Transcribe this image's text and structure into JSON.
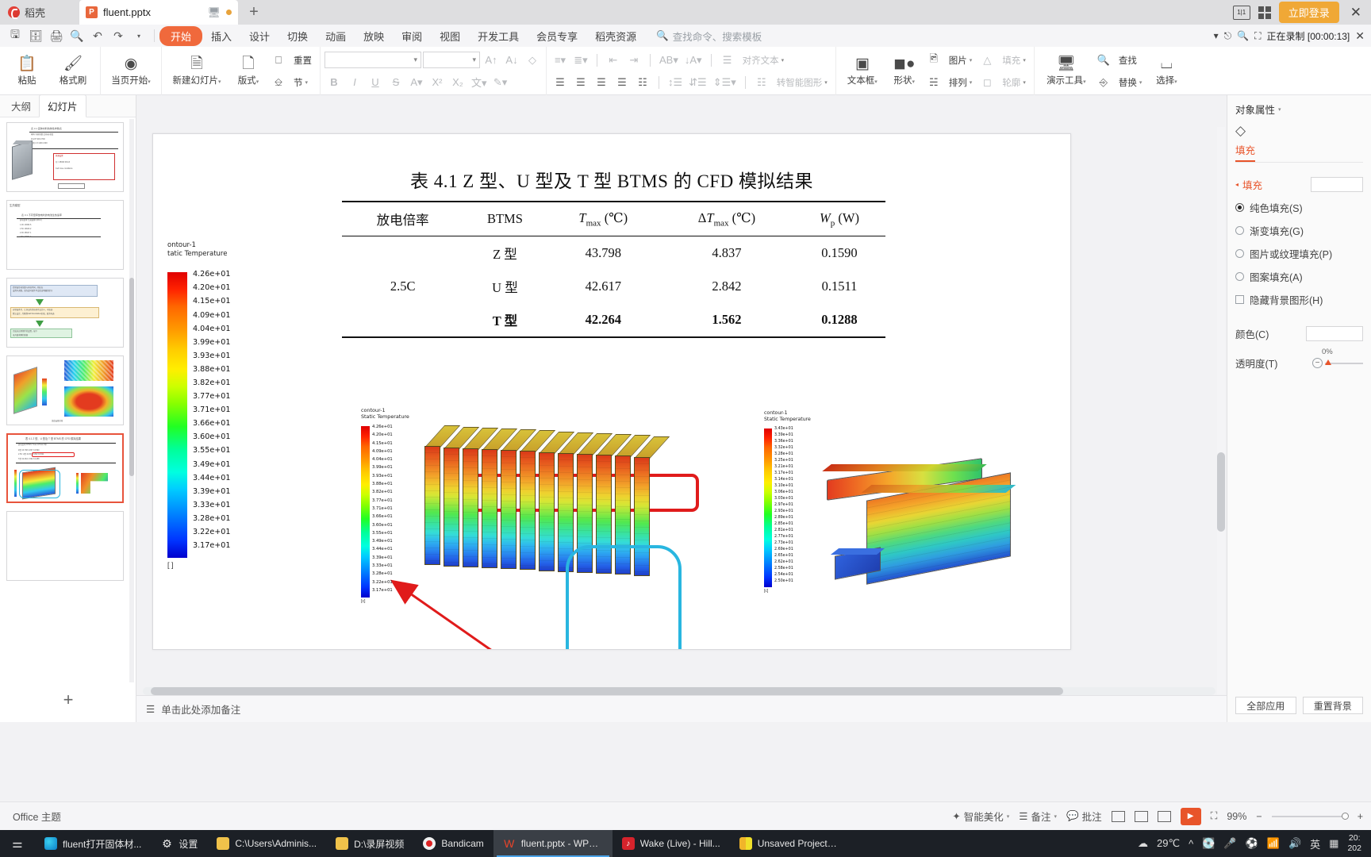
{
  "tabbar": {
    "home_label": "稻壳",
    "doc_tab": "fluent.pptx",
    "plus": "+",
    "login_label": "立即登录",
    "close": "✕"
  },
  "menubar": {
    "quick_icons": [
      "save-icon",
      "save-as-icon",
      "print-icon",
      "print-preview-icon",
      "undo-icon",
      "redo-icon",
      "customize-icon"
    ],
    "items": [
      {
        "label": "开始",
        "active": true
      },
      {
        "label": "插入",
        "active": false
      },
      {
        "label": "设计",
        "active": false
      },
      {
        "label": "切换",
        "active": false
      },
      {
        "label": "动画",
        "active": false
      },
      {
        "label": "放映",
        "active": false
      },
      {
        "label": "审阅",
        "active": false
      },
      {
        "label": "视图",
        "active": false
      },
      {
        "label": "开发工具",
        "active": false
      },
      {
        "label": "会员专享",
        "active": false
      },
      {
        "label": "稻壳资源",
        "active": false
      }
    ],
    "search_placeholder": "查找命令、搜索模板",
    "recording_label": "正在录制 [00:00:13]"
  },
  "ribbon": {
    "clipboard": {
      "paste": "粘贴",
      "format_painter": "格式刷"
    },
    "slides": {
      "from_current": "当页开始",
      "new_slide": "新建幻灯片",
      "layout": "版式",
      "reset": "重置",
      "section": "节"
    },
    "font": {
      "font_name": "",
      "font_size": "",
      "bold": "B",
      "italic": "I",
      "underline": "U",
      "strike": "S"
    },
    "paragraph": {
      "align_text": "对齐文本",
      "smart_art": "转智能图形"
    },
    "insert": {
      "textbox": "文本框",
      "shape": "形状",
      "picture": "图片",
      "arrange": "排列",
      "fill": "填充",
      "outline": "轮廓"
    },
    "tools": {
      "present_tools": "演示工具",
      "find": "查找",
      "replace": "替换",
      "select": "选择"
    }
  },
  "left_pane": {
    "tabs": [
      {
        "label": "大纲",
        "active": false
      },
      {
        "label": "幻灯片",
        "active": true
      }
    ],
    "add_slide": "+",
    "slide_count": 6,
    "selected_index": 5
  },
  "slide": {
    "title": "表 4.1 Z 型、U 型及 T 型 BTMS 的 CFD 模拟结果",
    "table": {
      "headers": [
        "放电倍率",
        "BTMS",
        "Tmax (℃)",
        "ΔTmax (℃)",
        "Wp (W)"
      ],
      "rate": "2.5C",
      "rows": [
        {
          "btms": "Z 型",
          "tmax": "43.798",
          "dtmax": "4.837",
          "wp": "0.1590",
          "bold": false,
          "highlight": false
        },
        {
          "btms": "U 型",
          "tmax": "42.617",
          "dtmax": "2.842",
          "wp": "0.1511",
          "bold": false,
          "highlight": true
        },
        {
          "btms": "T 型",
          "tmax": "42.264",
          "dtmax": "1.562",
          "wp": "0.1288",
          "bold": true,
          "highlight": false
        }
      ]
    },
    "colorbar_big": {
      "title_line1": "ontour-1",
      "title_line2": "tatic Temperature",
      "unit": "[ ]",
      "labels": [
        "4.26e+01",
        "4.20e+01",
        "4.15e+01",
        "4.09e+01",
        "4.04e+01",
        "3.99e+01",
        "3.93e+01",
        "3.88e+01",
        "3.82e+01",
        "3.77e+01",
        "3.71e+01",
        "3.66e+01",
        "3.60e+01",
        "3.55e+01",
        "3.49e+01",
        "3.44e+01",
        "3.39e+01",
        "3.33e+01",
        "3.28e+01",
        "3.22e+01",
        "3.17e+01"
      ]
    },
    "colorbar_left_small": {
      "title_line1": "contour-1",
      "title_line2": "Static Temperature",
      "unit": "[c]",
      "labels": [
        "4.26e+01",
        "4.20e+01",
        "4.15e+01",
        "4.09e+01",
        "4.04e+01",
        "3.99e+01",
        "3.93e+01",
        "3.88e+01",
        "3.82e+01",
        "3.77e+01",
        "3.71e+01",
        "3.66e+01",
        "3.60e+01",
        "3.55e+01",
        "3.49e+01",
        "3.44e+01",
        "3.39e+01",
        "3.33e+01",
        "3.28e+01",
        "3.22e+01",
        "3.17e+01"
      ]
    },
    "colorbar_right_small": {
      "title_line1": "contour-1",
      "title_line2": "Static Temperature",
      "unit": "[c]",
      "labels": [
        "3.43e+01",
        "3.39e+01",
        "3.36e+01",
        "3.32e+01",
        "3.28e+01",
        "3.25e+01",
        "3.21e+01",
        "3.17e+01",
        "3.14e+01",
        "3.10e+01",
        "3.06e+01",
        "3.03e+01",
        "2.97e+01",
        "2.93e+01",
        "2.89e+01",
        "2.85e+01",
        "2.81e+01",
        "2.77e+01",
        "2.73e+01",
        "2.69e+01",
        "2.65e+01",
        "2.62e+01",
        "2.58e+01",
        "2.54e+01",
        "2.50e+01"
      ]
    },
    "annotations": {
      "red_box": "highlight-u-row",
      "blue_box": "highlight-zpack",
      "red_arrow": "arrow-to-colorbar"
    }
  },
  "right_pane": {
    "title": "对象属性",
    "tab": "填充",
    "section": "填充",
    "options": [
      {
        "label": "纯色填充(S)",
        "type": "radio",
        "checked": true
      },
      {
        "label": "渐变填充(G)",
        "type": "radio",
        "checked": false
      },
      {
        "label": "图片或纹理填充(P)",
        "type": "radio",
        "checked": false
      },
      {
        "label": "图案填充(A)",
        "type": "radio",
        "checked": false
      },
      {
        "label": "隐藏背景图形(H)",
        "type": "checkbox",
        "checked": false
      }
    ],
    "color_label": "颜色(C)",
    "transparency_label": "透明度(T)",
    "transparency_value": "0%",
    "apply_all": "全部应用",
    "reset_bg": "重置背景"
  },
  "statusbar": {
    "note_hint": "单击此处添加备注",
    "beautify": "智能美化",
    "notes": "备注",
    "comments": "批注",
    "zoom": "99%",
    "zoom_out": "−",
    "zoom_in": "+"
  },
  "taskbar": {
    "items": [
      {
        "label": "fluent打开固体材...",
        "icon": "edge-icon",
        "active": false
      },
      {
        "label": "设置",
        "icon": "gear-icon",
        "active": false
      },
      {
        "label": "C:\\Users\\Adminis...",
        "icon": "folder-icon",
        "active": false
      },
      {
        "label": "D:\\录屏视频",
        "icon": "folder-icon",
        "active": false
      },
      {
        "label": "Bandicam",
        "icon": "bandicam-icon",
        "active": false
      },
      {
        "label": "fluent.pptx - WPS...",
        "icon": "wps-icon",
        "active": true
      },
      {
        "label": "Wake (Live) - Hill...",
        "icon": "netease-icon",
        "active": false
      },
      {
        "label": "Unsaved Project -...",
        "icon": "project-icon",
        "active": false
      }
    ],
    "weather": "29℃",
    "ime": "英",
    "clock_time": "20:",
    "clock_date": "202"
  }
}
